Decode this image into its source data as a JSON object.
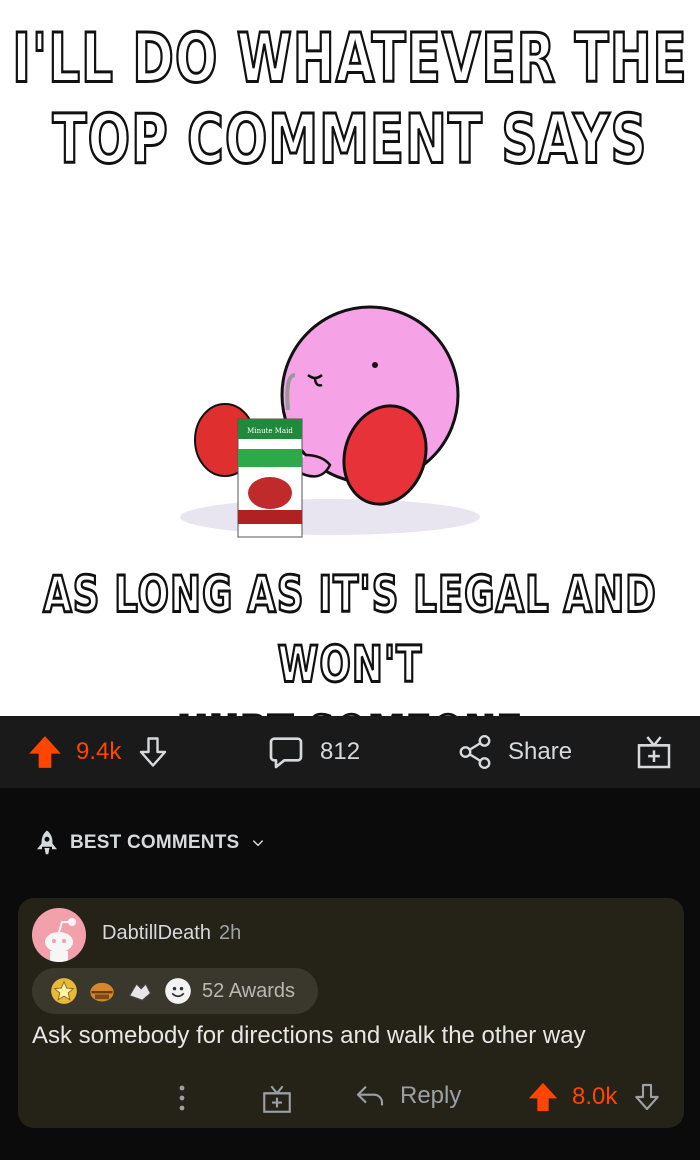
{
  "meme": {
    "top_caption_line1": "I'LL DO WHATEVER THE",
    "top_caption_line2": "TOP COMMENT SAYS",
    "bottom_caption_line1": "AS LONG AS IT'S LEGAL AND WON'T",
    "bottom_caption_line2": "HURT SOMEONE",
    "juice_box_brand": "Minute Maid"
  },
  "post_actions": {
    "score": "9.4k",
    "comment_count": "812",
    "share_label": "Share"
  },
  "sort": {
    "label": "BEST COMMENTS"
  },
  "comment": {
    "author": "DabtillDeath",
    "time": "2h",
    "awards_label": "52 Awards",
    "body": "Ask somebody for directions and walk the other way",
    "reply_label": "Reply",
    "score": "8.0k"
  },
  "colors": {
    "accent": "#ff4500",
    "bar_bg": "#1a1a1b",
    "page_bg": "#0b0b0b",
    "comment_bg": "#252218",
    "text": "#d7dadc"
  }
}
